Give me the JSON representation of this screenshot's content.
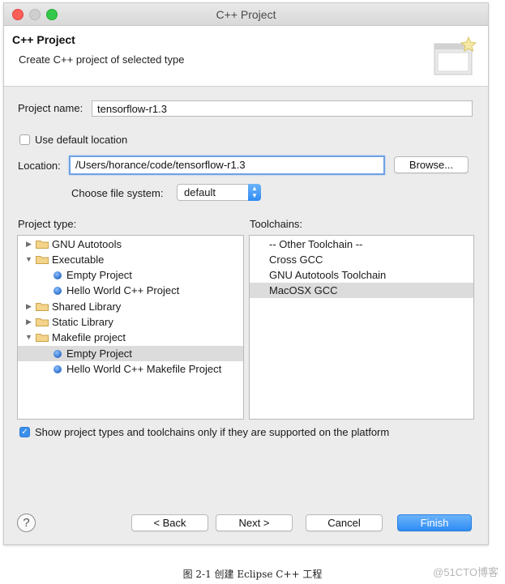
{
  "window": {
    "title": "C++ Project"
  },
  "banner": {
    "title": "C++ Project",
    "description": "Create C++ project of selected type"
  },
  "form": {
    "project_name_label": "Project name:",
    "project_name_value": "tensorflow-r1.3",
    "use_default_location_label": "Use default location",
    "location_label": "Location:",
    "location_value": "/Users/horance/code/tensorflow-r1.3",
    "browse_label": "Browse...",
    "file_system_label": "Choose file system:",
    "file_system_value": "default"
  },
  "project_type": {
    "heading": "Project type:",
    "items": [
      {
        "label": "GNU Autotools",
        "kind": "folder",
        "expanded": false
      },
      {
        "label": "Executable",
        "kind": "folder",
        "expanded": true
      },
      {
        "label": "Empty Project",
        "kind": "leaf"
      },
      {
        "label": "Hello World C++ Project",
        "kind": "leaf"
      },
      {
        "label": "Shared Library",
        "kind": "folder",
        "expanded": false
      },
      {
        "label": "Static Library",
        "kind": "folder",
        "expanded": false
      },
      {
        "label": "Makefile project",
        "kind": "folder",
        "expanded": true
      },
      {
        "label": "Empty Project",
        "kind": "leaf",
        "selected": true
      },
      {
        "label": "Hello World C++ Makefile Project",
        "kind": "leaf"
      }
    ]
  },
  "toolchains": {
    "heading": "Toolchains:",
    "items": [
      {
        "label": "-- Other Toolchain --"
      },
      {
        "label": "Cross GCC"
      },
      {
        "label": "GNU Autotools Toolchain"
      },
      {
        "label": "MacOSX GCC",
        "selected": true
      }
    ]
  },
  "filter_checkbox_label": "Show project types and toolchains only if they are supported on the platform",
  "buttons": {
    "help": "?",
    "back": "< Back",
    "next": "Next >",
    "cancel": "Cancel",
    "finish": "Finish"
  },
  "caption": "图 2-1  创建 Eclipse C++ 工程",
  "watermark": "@51CTO博客",
  "colors": {
    "accent": "#2d8cf4",
    "selection": "#dcdcdc",
    "close": "#fc5f57",
    "maximize": "#34c84a"
  }
}
